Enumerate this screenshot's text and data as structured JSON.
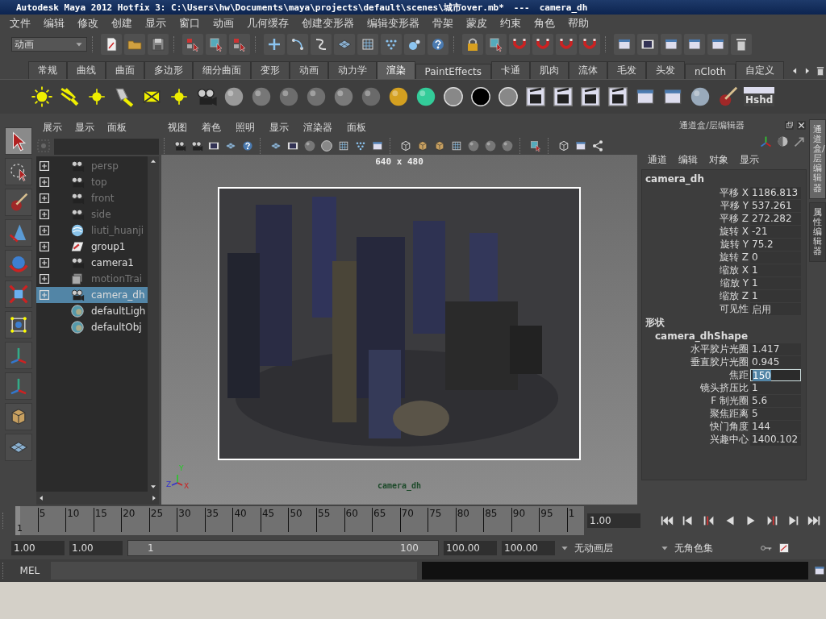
{
  "window": {
    "title": "Autodesk Maya 2012 Hotfix 3: C:\\Users\\hw\\Documents\\maya\\projects\\default\\scenes\\城市over.mb*",
    "separator": "---",
    "panel": "camera_dh"
  },
  "menu": [
    "文件",
    "编辑",
    "修改",
    "创建",
    "显示",
    "窗口",
    "动画",
    "几何缓存",
    "创建变形器",
    "编辑变形器",
    "骨架",
    "蒙皮",
    "约束",
    "角色",
    "帮助"
  ],
  "status_line": {
    "menu_set": "动画"
  },
  "shelf": {
    "tabs": [
      {
        "label": "常规",
        "selected": false
      },
      {
        "label": "曲线",
        "selected": false
      },
      {
        "label": "曲面",
        "selected": false
      },
      {
        "label": "多边形",
        "selected": false
      },
      {
        "label": "细分曲面",
        "selected": false
      },
      {
        "label": "变形",
        "selected": false
      },
      {
        "label": "动画",
        "selected": false
      },
      {
        "label": "动力学",
        "selected": false
      },
      {
        "label": "渲染",
        "selected": true
      },
      {
        "label": "PaintEffects",
        "selected": false
      },
      {
        "label": "卡通",
        "selected": false
      },
      {
        "label": "肌肉",
        "selected": false
      },
      {
        "label": "流体",
        "selected": false
      },
      {
        "label": "毛发",
        "selected": false
      },
      {
        "label": "头发",
        "selected": false
      },
      {
        "label": "nCloth",
        "selected": false
      },
      {
        "label": "自定义",
        "selected": false
      }
    ],
    "last_button": "Hshd"
  },
  "toolbox": [
    {
      "kind": "select",
      "selected": true
    },
    {
      "kind": "lasso",
      "selected": false
    },
    {
      "kind": "paint",
      "selected": false
    },
    {
      "kind": "move",
      "selected": false
    },
    {
      "kind": "rotate",
      "selected": false
    },
    {
      "kind": "scale",
      "selected": false
    },
    {
      "kind": "manip",
      "selected": false
    },
    {
      "kind": "soft",
      "selected": false
    },
    {
      "kind": "last",
      "selected": false
    },
    {
      "kind": "object",
      "selected": false
    },
    {
      "kind": "layout",
      "selected": false
    }
  ],
  "outliner": {
    "menu": [
      "展示",
      "显示",
      "面板"
    ],
    "items": [
      {
        "kind": "camera",
        "label": "persp",
        "dimmed": true,
        "expandable": true,
        "selected": false
      },
      {
        "kind": "camera",
        "label": "top",
        "dimmed": true,
        "expandable": true,
        "selected": false
      },
      {
        "kind": "camera",
        "label": "front",
        "dimmed": true,
        "expandable": true,
        "selected": false
      },
      {
        "kind": "camera",
        "label": "side",
        "dimmed": true,
        "expandable": true,
        "selected": false
      },
      {
        "kind": "fluid",
        "label": "liuti_huanji",
        "dimmed": true,
        "expandable": true,
        "selected": false
      },
      {
        "kind": "group",
        "label": "group1",
        "dimmed": false,
        "expandable": true,
        "selected": false
      },
      {
        "kind": "camera",
        "label": "camera1",
        "dimmed": false,
        "expandable": true,
        "selected": false
      },
      {
        "kind": "trail",
        "label": "motionTrai",
        "dimmed": true,
        "expandable": true,
        "selected": false
      },
      {
        "kind": "camera",
        "label": "camera_dh",
        "dimmed": false,
        "expandable": true,
        "selected": true
      },
      {
        "kind": "set",
        "label": "defaultLigh",
        "dimmed": false,
        "expandable": false,
        "selected": false
      },
      {
        "kind": "set",
        "label": "defaultObj",
        "dimmed": false,
        "expandable": false,
        "selected": false
      }
    ]
  },
  "viewport": {
    "menu": [
      "视图",
      "着色",
      "照明",
      "显示",
      "渲染器",
      "面板"
    ],
    "resolution": "640 x 480",
    "camera": "camera_dh",
    "axes": [
      "Y",
      "Z",
      "X"
    ]
  },
  "channel_box": {
    "title": "通道盒/层编辑器",
    "menu": [
      "通道",
      "编辑",
      "对象",
      "显示"
    ],
    "object": "camera_dh",
    "channels": [
      {
        "label": "平移 X",
        "value": "1186.813",
        "editing": false
      },
      {
        "label": "平移 Y",
        "value": "537.261",
        "editing": false
      },
      {
        "label": "平移 Z",
        "value": "272.282",
        "editing": false
      },
      {
        "label": "旋转 X",
        "value": "-21",
        "editing": false
      },
      {
        "label": "旋转 Y",
        "value": "75.2",
        "editing": false
      },
      {
        "label": "旋转 Z",
        "value": "0",
        "editing": false
      },
      {
        "label": "缩放 X",
        "value": "1",
        "editing": false
      },
      {
        "label": "缩放 Y",
        "value": "1",
        "editing": false
      },
      {
        "label": "缩放 Z",
        "value": "1",
        "editing": false
      },
      {
        "label": "可见性",
        "value": "启用",
        "editing": false
      }
    ],
    "shapes_heading": "形状",
    "shape": "camera_dhShape",
    "shape_channels": [
      {
        "label": "水平胶片光圈",
        "value": "1.417",
        "editing": false
      },
      {
        "label": "垂直胶片光圈",
        "value": "0.945",
        "editing": false
      },
      {
        "label": "焦距",
        "value": "150",
        "editing": true
      },
      {
        "label": "镜头挤压比",
        "value": "1",
        "editing": false
      },
      {
        "label": "F 制光圈",
        "value": "5.6",
        "editing": false
      },
      {
        "label": "聚焦距离",
        "value": "5",
        "editing": false
      },
      {
        "label": "快门角度",
        "value": "144",
        "editing": false
      },
      {
        "label": "兴趣中心",
        "value": "1400.102",
        "editing": false
      }
    ]
  },
  "side_tabs": [
    {
      "label": "通道盒/层编辑器",
      "selected": true
    },
    {
      "label": "属性编辑器",
      "selected": false
    }
  ],
  "time_slider": {
    "level": 0,
    "current_frame": "1",
    "ticks": [
      "5",
      "10",
      "15",
      "20",
      "25",
      "30",
      "35",
      "40",
      "45",
      "50",
      "55",
      "60",
      "65",
      "70",
      "75",
      "80",
      "85",
      "90",
      "95",
      "1"
    ],
    "frame_field": "1.00"
  },
  "range_slider": {
    "level": 1,
    "start": "1.00",
    "playback_start": "1.00",
    "range_start": "1",
    "range_end": "100",
    "playback_end": "100.00",
    "end": "100.00",
    "anim_layer": "无动画层",
    "character_set": "无角色集"
  },
  "command_line": {
    "label": "MEL"
  }
}
